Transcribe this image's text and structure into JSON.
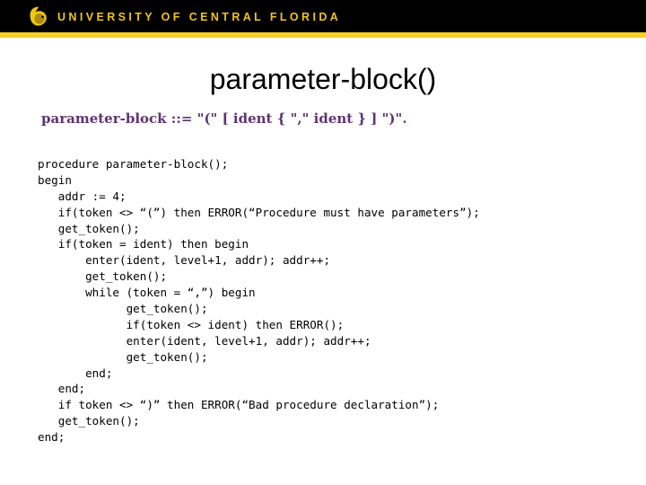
{
  "header": {
    "wordmark": "UNIVERSITY OF CENTRAL FLORIDA",
    "logo_icon": "ucf-pegasus-icon",
    "bar_color": "#000000",
    "stripe_color": "#f5cf2a",
    "wordmark_color": "#f0c518"
  },
  "slide": {
    "title": "parameter-block()",
    "title_color": "#000000",
    "background_color": "#ffffff"
  },
  "grammar": {
    "color": "#5f3372",
    "nonterminal": "parameter-block",
    "operator": "::=",
    "production": "\"(\" [ ident { \",\" ident } ] \")\".",
    "full_text": "parameter-block ::= \"(\" [ ident { \",\" ident } ] \")\"."
  },
  "code": {
    "color": "#000000",
    "lines": [
      "procedure parameter-block();",
      "begin",
      "   addr := 4;",
      "   if(token <> “(”) then ERROR(“Procedure must have parameters”);",
      "   get_token();",
      "   if(token = ident) then begin",
      "       enter(ident, level+1, addr); addr++;",
      "       get_token();",
      "       while (token = “,”) begin",
      "             get_token();",
      "             if(token <> ident) then ERROR();",
      "             enter(ident, level+1, addr); addr++;",
      "             get_token();",
      "       end;",
      "   end;",
      "   if token <> “)” then ERROR(“Bad procedure declaration”);",
      "   get_token();",
      "end;"
    ]
  }
}
